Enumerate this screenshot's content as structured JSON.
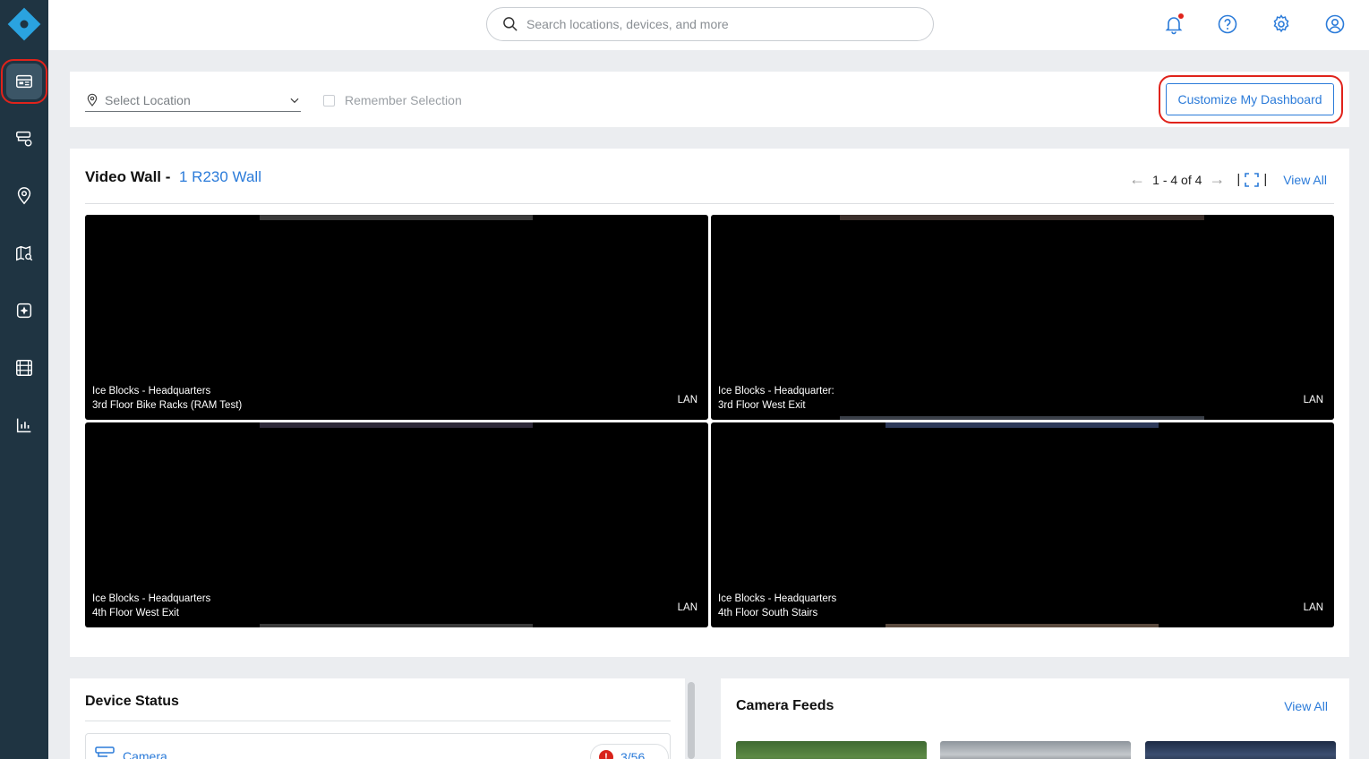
{
  "topbar": {
    "search_placeholder": "Search locations, devices, and more"
  },
  "sidebar": {
    "items": [
      {
        "icon": "dashboard-icon",
        "active": true
      },
      {
        "icon": "devices-icon"
      },
      {
        "icon": "location-pin-icon"
      },
      {
        "icon": "map-search-icon"
      },
      {
        "icon": "plugin-icon"
      },
      {
        "icon": "film-icon"
      },
      {
        "icon": "bar-chart-icon"
      }
    ]
  },
  "location_bar": {
    "select_placeholder": "Select Location",
    "remember_label": "Remember Selection",
    "customize_button": "Customize My Dashboard"
  },
  "video_wall": {
    "title": "Video Wall -",
    "wall_name": "1 R230 Wall",
    "pagination": "1 - 4 of 4",
    "view_all": "View All",
    "tiles": [
      {
        "site": "Ice Blocks - Headquarters",
        "camera": "3rd Floor Bike Racks (RAM Test)",
        "network": "LAN"
      },
      {
        "site": "Ice Blocks - Headquarter:",
        "camera": "3rd Floor West Exit",
        "network": "LAN"
      },
      {
        "site": "Ice Blocks - Headquarters",
        "camera": "4th Floor West Exit",
        "network": "LAN"
      },
      {
        "site": "Ice Blocks - Headquarters",
        "camera": "4th Floor South Stairs",
        "network": "LAN"
      }
    ]
  },
  "device_status": {
    "title": "Device Status",
    "rows": [
      {
        "label": "Camera",
        "badge": "3/56",
        "badge_icon": "!"
      }
    ]
  },
  "camera_feeds": {
    "title": "Camera Feeds",
    "view_all": "View All"
  },
  "colors": {
    "accent": "#2b7bd9",
    "sidebar": "#1f3442",
    "highlight": "#e0231b"
  }
}
